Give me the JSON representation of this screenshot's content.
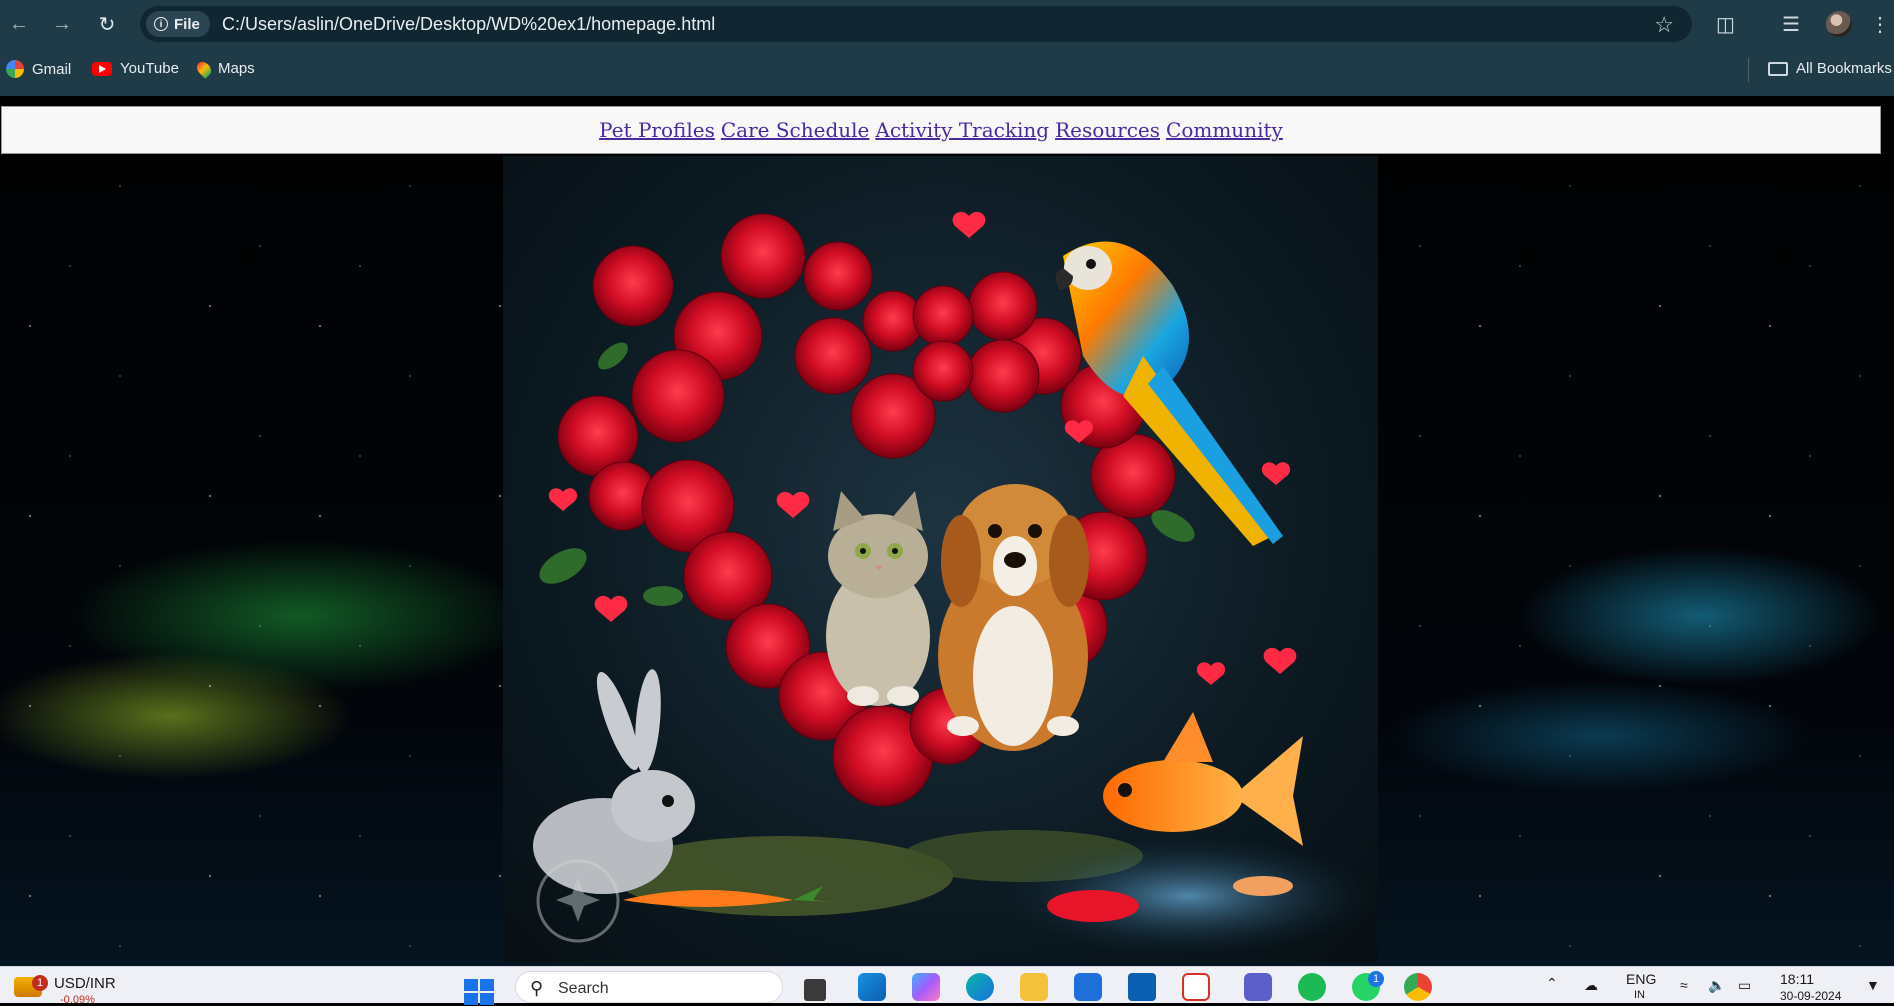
{
  "browser": {
    "site_chip": "File",
    "url": "C:/Users/aslin/OneDrive/Desktop/WD%20ex1/homepage.html",
    "bookmarks": [
      {
        "label": "Gmail",
        "icon": "gmail-icon"
      },
      {
        "label": "YouTube",
        "icon": "youtube-icon"
      },
      {
        "label": "Maps",
        "icon": "maps-icon"
      }
    ],
    "all_bookmarks": "All Bookmarks"
  },
  "nav": {
    "links": [
      "Pet Profiles",
      "Care Schedule",
      "Activity Tracking",
      "Resources",
      "Community"
    ],
    "link_color": "#4b2aa0"
  },
  "hero": {
    "subjects": [
      "rose-heart",
      "cat",
      "dog",
      "parrot",
      "rabbit",
      "goldfish",
      "carrot"
    ]
  },
  "taskbar": {
    "widget_label": "USD/INR",
    "widget_sub": "-0.09%",
    "widget_badge": "1",
    "search_placeholder": "Search",
    "whatsapp_badge": "1",
    "lang": "ENG",
    "lang_sub": "IN",
    "time": "18:11",
    "date": "30-09-2024"
  },
  "colors": {
    "chrome_bg": "#1f3b47",
    "omnibox_bg": "#102631",
    "navbar_bg": "#f8f8f8",
    "taskbar_bg": "#eef0f6"
  }
}
